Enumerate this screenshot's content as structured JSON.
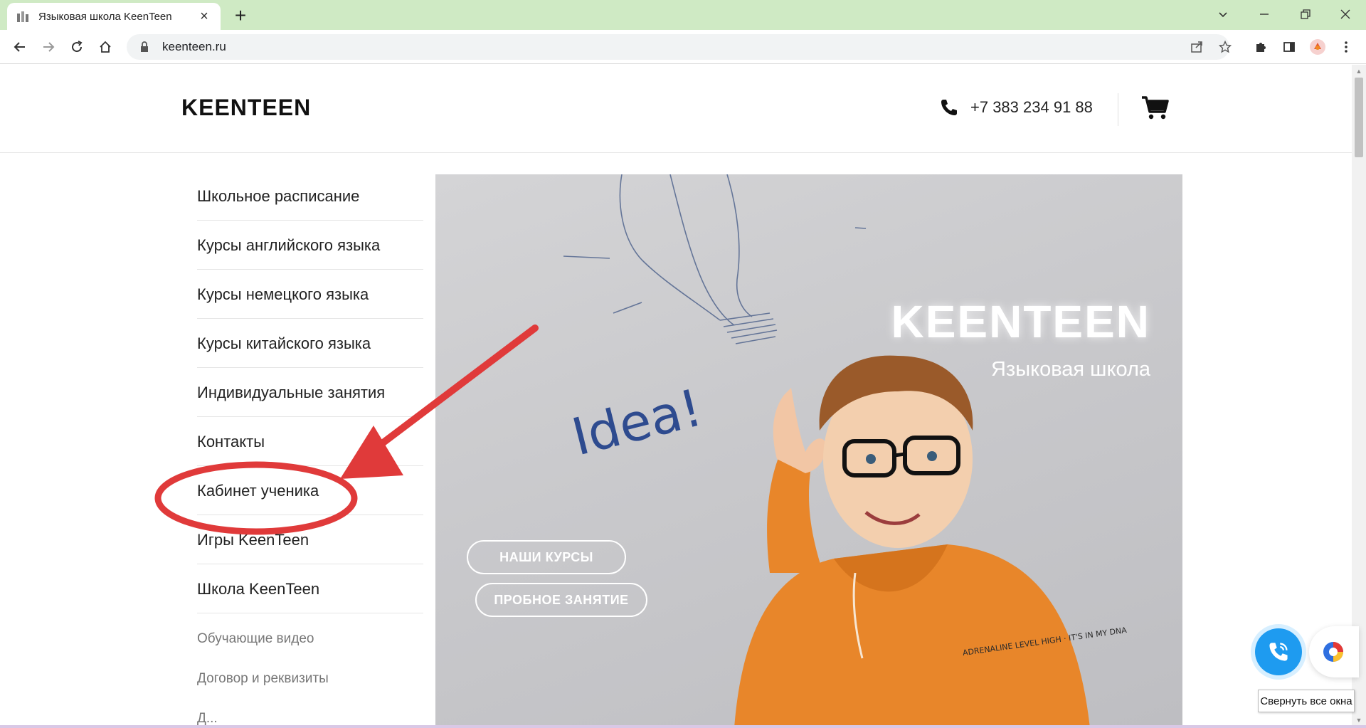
{
  "browser": {
    "tab_title": "Языковая школа KeenTeen",
    "url": "keenteen.ru"
  },
  "site": {
    "logo": "KEENTEEN",
    "phone": "+7 383 234 91 88"
  },
  "menu": {
    "items": [
      {
        "label": "Школьное расписание"
      },
      {
        "label": "Курсы английского языка"
      },
      {
        "label": "Курсы немецкого языка"
      },
      {
        "label": "Курсы китайского языка"
      },
      {
        "label": "Индивидуальные занятия"
      },
      {
        "label": "Контакты"
      },
      {
        "label": "Кабинет ученика"
      },
      {
        "label": "Игры KeenTeen"
      },
      {
        "label": "Школа KeenTeen"
      }
    ],
    "secondary": [
      {
        "label": "Обучающие видео"
      },
      {
        "label": "Договор и реквизиты"
      },
      {
        "label": "Д..."
      }
    ]
  },
  "hero": {
    "title": "KEENTEEN",
    "subtitle": "Языковая школа",
    "board_text": "Idea!",
    "shirt_text": "ADRENALINE LEVEL HIGH · IT'S IN MY DNA",
    "buttons": {
      "courses": "НАШИ КУРСЫ",
      "trial": "ПРОБНОЕ ЗАНЯТИЕ"
    }
  },
  "tooltip": "Свернуть все окна",
  "annotation": {
    "highlighted_item": "Кабинет ученика",
    "color": "#e03a3a"
  },
  "colors": {
    "tabstrip": "#cfeac4",
    "call_widget": "#1e9bf0",
    "hoodie": "#e8862a"
  }
}
